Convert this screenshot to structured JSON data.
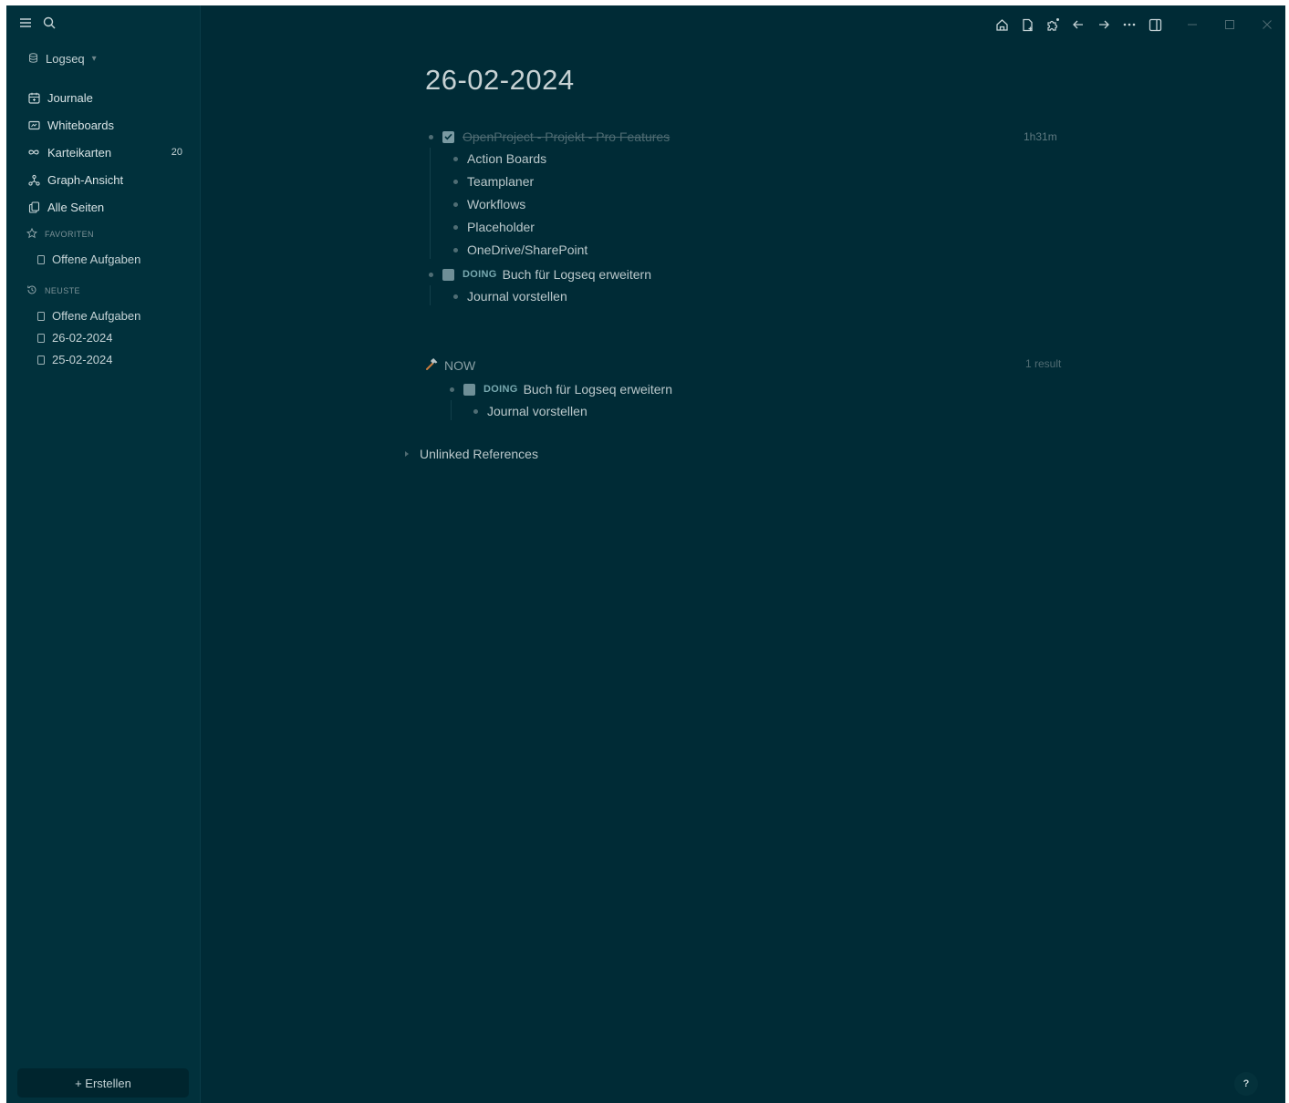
{
  "sidebar": {
    "graph_name": "Logseq",
    "nav": [
      {
        "label": "Journale",
        "icon": "calendar-icon"
      },
      {
        "label": "Whiteboards",
        "icon": "whiteboard-icon"
      },
      {
        "label": "Karteikarten",
        "icon": "infinity-icon",
        "count": "20"
      },
      {
        "label": "Graph-Ansicht",
        "icon": "graph-icon"
      },
      {
        "label": "Alle Seiten",
        "icon": "pages-icon"
      }
    ],
    "favorites_header": "FAVORITEN",
    "favorites": [
      "Offene Aufgaben"
    ],
    "recent_header": "NEUSTE",
    "recent": [
      "Offene Aufgaben",
      "26-02-2024",
      "25-02-2024"
    ],
    "create_label": "+ Erstellen"
  },
  "page": {
    "title": "26-02-2024",
    "blocks": {
      "task_done": "OpenProject - Projekt - Pro Features",
      "task_done_time": "1h31m",
      "children": [
        "Action Boards",
        "Teamplaner",
        "Workflows",
        "Placeholder",
        "OneDrive/SharePoint"
      ],
      "task_doing_marker": "DOING",
      "task_doing": "Buch für Logseq erweitern",
      "task_doing_child": "Journal vorstellen"
    },
    "query": {
      "title": "NOW",
      "result_count": "1 result",
      "marker": "DOING",
      "task": "Buch für Logseq erweitern",
      "child": "Journal vorstellen"
    },
    "unlinked_label": "Unlinked References"
  },
  "help_label": "?"
}
